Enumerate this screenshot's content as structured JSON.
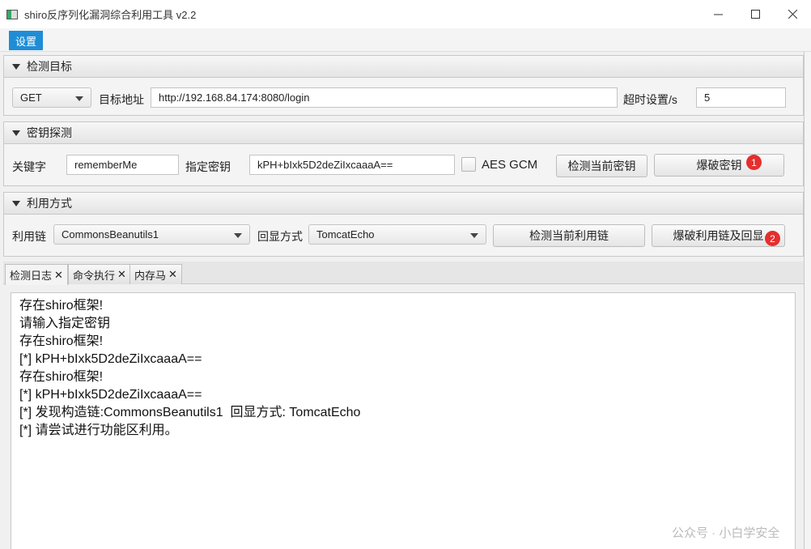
{
  "window": {
    "title": "shiro反序列化漏洞综合利用工具 v2.2"
  },
  "menu": {
    "settings": "设置"
  },
  "target_section": {
    "title": "检测目标",
    "method": "GET",
    "url_label": "目标地址",
    "url_value": "http://192.168.84.174:8080/login",
    "timeout_label": "超时设置/s",
    "timeout_value": "5"
  },
  "key_section": {
    "title": "密钥探测",
    "keyword_label": "关键字",
    "keyword_value": "rememberMe",
    "key_label": "指定密钥",
    "key_value": "kPH+bIxk5D2deZiIxcaaaA==",
    "aes_gcm_label": "AES GCM",
    "detect_key_button": "检测当前密钥",
    "brute_key_button": "爆破密钥",
    "badge": "1"
  },
  "exploit_section": {
    "title": "利用方式",
    "chain_label": "利用链",
    "chain_value": "CommonsBeanutils1",
    "echo_label": "回显方式",
    "echo_value": "TomcatEcho",
    "detect_chain_button": "检测当前利用链",
    "brute_chain_button": "爆破利用链及回显",
    "badge": "2"
  },
  "tabs": [
    {
      "label": "检测日志"
    },
    {
      "label": "命令执行"
    },
    {
      "label": "内存马"
    }
  ],
  "log_lines": [
    "存在shiro框架!",
    "请输入指定密钥",
    "存在shiro框架!",
    "[*] kPH+bIxk5D2deZiIxcaaaA==",
    "存在shiro框架!",
    "[*] kPH+bIxk5D2deZiIxcaaaA==",
    "[*] 发现构造链:CommonsBeanutils1  回显方式: TomcatEcho",
    "[*] 请尝试进行功能区利用。"
  ],
  "watermark": "公众号 · 小白学安全"
}
